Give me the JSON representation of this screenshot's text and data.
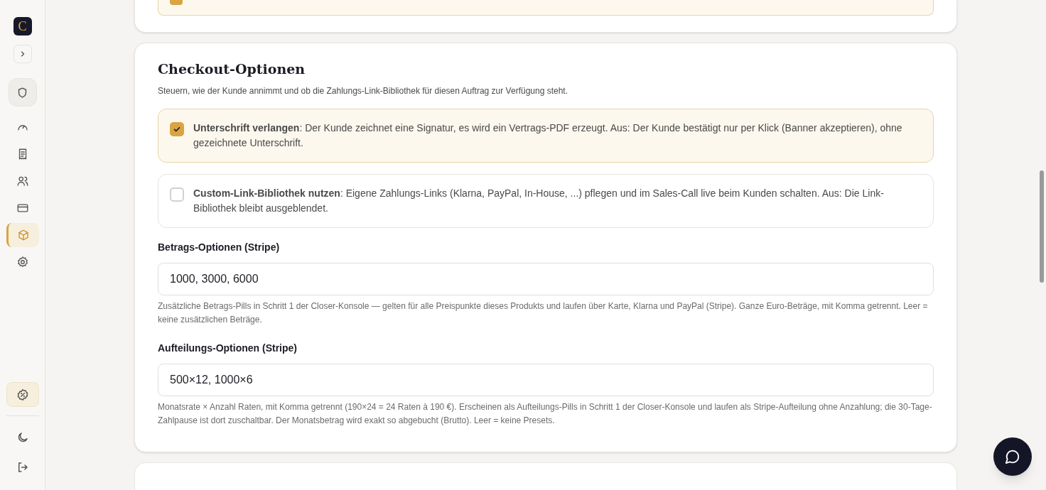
{
  "sidebar": {
    "logo": "C",
    "nav": [
      {
        "selected": false
      },
      {
        "selected": false
      },
      {
        "selected": false
      },
      {
        "selected": false
      },
      {
        "selected": true
      },
      {
        "selected": false
      }
    ]
  },
  "previous_card": {
    "option_checked": true
  },
  "checkout": {
    "title": "Checkout-Optionen",
    "description": "Steuern, wie der Kunde annimmt und ob die Zahlungs-Link-Bibliothek für diesen Auftrag zur Verfügung steht.",
    "options": [
      {
        "text": "**Unterschrift verlangen**: Der Kunde zeichnet eine Signatur, es wird ein Vertrags-PDF erzeugt. Aus: Der Kunde bestätigt nur per Klick (Banner akzeptieren), ohne gezeichnete Unterschrift.",
        "checked": true
      },
      {
        "text": "**Custom-Link-Bibliothek nutzen**: Eigene Zahlungs-Links (Klarna, PayPal, In-House, ...) pflegen und im Sales-Call live beim Kunden schalten. Aus: Die Link-Bibliothek bleibt ausgeblendet.",
        "checked": false
      }
    ],
    "fields": [
      {
        "label": "Betrags-Optionen (Stripe)",
        "value": "1000, 3000, 6000",
        "help": "Zusätzliche Betrags-Pills in Schritt 1 der Closer-Konsole — gelten für alle Preispunkte dieses Produkts und laufen über Karte, Klarna und PayPal (Stripe). Ganze Euro-Beträge, mit Komma getrennt. Leer = keine zusätzlichen Beträge."
      },
      {
        "label": "Aufteilungs-Optionen (Stripe)",
        "value": "500×12, 1000×6",
        "help": "Monatsrate × Anzahl Raten, mit Komma getrennt (190×24 = 24 Raten à 190 €). Erscheinen als Aufteilungs-Pills in Schritt 1 der Closer-Konsole und laufen als Stripe-Aufteilung ohne Anzahlung; die 30-Tage-Zahlpause ist dort zuschaltbar. Der Monatsbetrag wird exakt so abgebucht (Brutto). Leer = keine Presets."
      }
    ]
  }
}
